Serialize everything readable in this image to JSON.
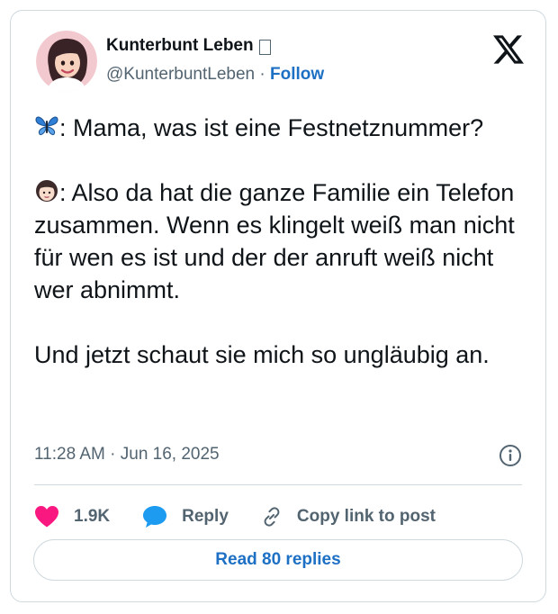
{
  "author": {
    "name": "Kunterbunt Leben",
    "handle": "@KunterbuntLeben",
    "separator": "·",
    "follow_label": "Follow",
    "avatar_icon": "cartoon-woman-avatar-icon"
  },
  "tweet": {
    "paragraphs": [
      {
        "emoji": "butterfly-icon",
        "text": ": Mama, was ist eine Festnetznummer?"
      },
      {
        "emoji": "girl-face-icon",
        "text": ": Also da hat die ganze Familie ein Telefon zusammen. Wenn es klingelt weiß man nicht für wen es ist und der der anruft weiß nicht wer abnimmt."
      },
      {
        "text": "Und jetzt schaut sie mich so ungläubig an."
      }
    ],
    "timestamp": "11:28 AM · Jun 16, 2025"
  },
  "actions": {
    "like_count": "1.9K",
    "reply_label": "Reply",
    "copy_link_label": "Copy link to post"
  },
  "read_replies_label": "Read 80 replies",
  "colors": {
    "accent": "#1d70c4",
    "heart": "#f91880",
    "reply_bubble": "#1d9bf0",
    "secondary_text": "#536471",
    "border": "#cfd9de"
  }
}
